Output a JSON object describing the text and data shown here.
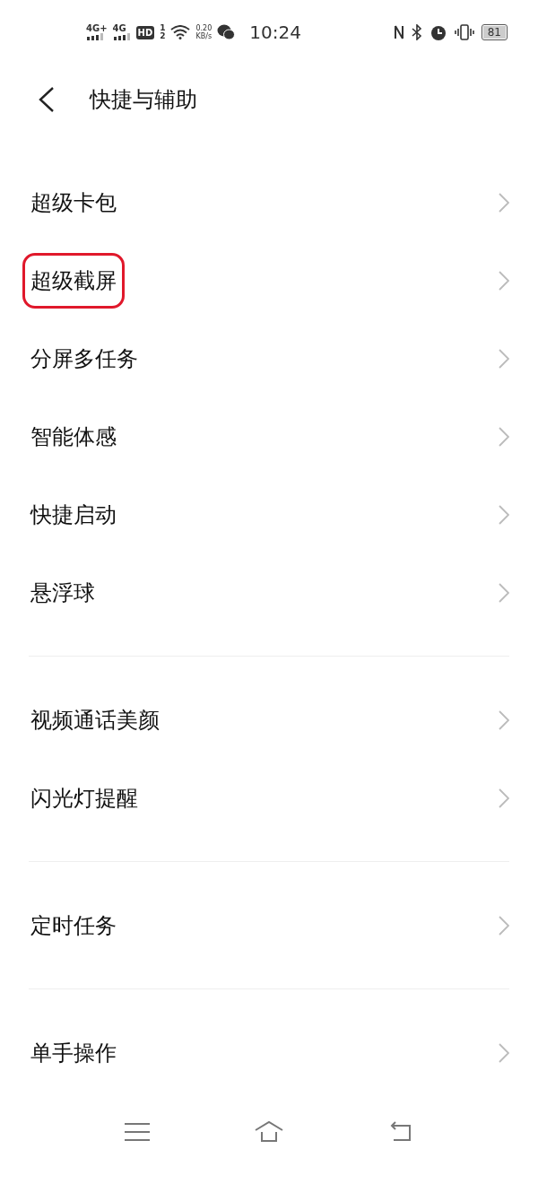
{
  "status_bar": {
    "network_1": "4G+",
    "network_2": "4G",
    "hd": "HD",
    "sim_1": "1",
    "sim_2": "2",
    "speed": "0.20",
    "speed_unit": "KB/s",
    "time": "10:24",
    "battery": "81"
  },
  "header": {
    "title": "快捷与辅助"
  },
  "groups": [
    {
      "items": [
        {
          "label": "超级卡包",
          "highlighted": false
        },
        {
          "label": "超级截屏",
          "highlighted": true
        },
        {
          "label": "分屏多任务",
          "highlighted": false
        },
        {
          "label": "智能体感",
          "highlighted": false
        },
        {
          "label": "快捷启动",
          "highlighted": false
        },
        {
          "label": "悬浮球",
          "highlighted": false
        }
      ]
    },
    {
      "items": [
        {
          "label": "视频通话美颜",
          "highlighted": false
        },
        {
          "label": "闪光灯提醒",
          "highlighted": false
        }
      ]
    },
    {
      "items": [
        {
          "label": "定时任务",
          "highlighted": false
        }
      ]
    },
    {
      "items": [
        {
          "label": "单手操作",
          "highlighted": false
        }
      ]
    }
  ]
}
